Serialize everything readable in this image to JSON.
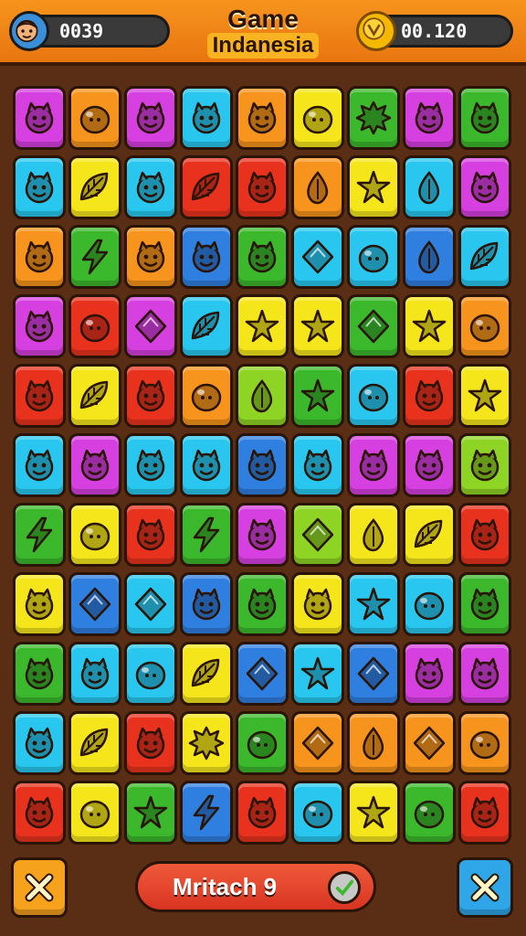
{
  "header": {
    "player_score": "0039",
    "coins": "00.120",
    "title_line1": "Game",
    "title_line2": "Indanesia"
  },
  "footer": {
    "match_label": "Mritach 9"
  },
  "colors": {
    "orange": "#f7941d",
    "yellow": "#f4e61b",
    "magenta": "#d63fe0",
    "cyan": "#29c7ef",
    "red": "#e8321e",
    "green": "#3bb82c",
    "blue": "#2f7fe0",
    "lime": "#8ed424"
  },
  "board": [
    [
      {
        "c": "magenta",
        "i": "face"
      },
      {
        "c": "orange",
        "i": "blob"
      },
      {
        "c": "magenta",
        "i": "face"
      },
      {
        "c": "cyan",
        "i": "face"
      },
      {
        "c": "orange",
        "i": "face"
      },
      {
        "c": "yellow",
        "i": "blob"
      },
      {
        "c": "green",
        "i": "splat"
      },
      {
        "c": "magenta",
        "i": "face"
      },
      {
        "c": "green",
        "i": "face"
      }
    ],
    [
      {
        "c": "cyan",
        "i": "face"
      },
      {
        "c": "yellow",
        "i": "leaf"
      },
      {
        "c": "cyan",
        "i": "face"
      },
      {
        "c": "red",
        "i": "leaf"
      },
      {
        "c": "red",
        "i": "face"
      },
      {
        "c": "orange",
        "i": "drop"
      },
      {
        "c": "yellow",
        "i": "star"
      },
      {
        "c": "cyan",
        "i": "drop"
      },
      {
        "c": "magenta",
        "i": "face"
      }
    ],
    [
      {
        "c": "orange",
        "i": "face"
      },
      {
        "c": "green",
        "i": "bolt"
      },
      {
        "c": "orange",
        "i": "face"
      },
      {
        "c": "blue",
        "i": "face"
      },
      {
        "c": "green",
        "i": "face"
      },
      {
        "c": "cyan",
        "i": "gem"
      },
      {
        "c": "cyan",
        "i": "blob"
      },
      {
        "c": "blue",
        "i": "drop"
      },
      {
        "c": "cyan",
        "i": "leaf"
      }
    ],
    [
      {
        "c": "magenta",
        "i": "face"
      },
      {
        "c": "red",
        "i": "blob"
      },
      {
        "c": "magenta",
        "i": "gem"
      },
      {
        "c": "cyan",
        "i": "leaf"
      },
      {
        "c": "yellow",
        "i": "star"
      },
      {
        "c": "yellow",
        "i": "star"
      },
      {
        "c": "green",
        "i": "gem"
      },
      {
        "c": "yellow",
        "i": "star"
      },
      {
        "c": "orange",
        "i": "blob"
      }
    ],
    [
      {
        "c": "red",
        "i": "face"
      },
      {
        "c": "yellow",
        "i": "leaf"
      },
      {
        "c": "red",
        "i": "face"
      },
      {
        "c": "orange",
        "i": "blob"
      },
      {
        "c": "lime",
        "i": "drop"
      },
      {
        "c": "green",
        "i": "star"
      },
      {
        "c": "cyan",
        "i": "blob"
      },
      {
        "c": "red",
        "i": "face"
      },
      {
        "c": "yellow",
        "i": "star"
      }
    ],
    [
      {
        "c": "cyan",
        "i": "face"
      },
      {
        "c": "magenta",
        "i": "face"
      },
      {
        "c": "cyan",
        "i": "face"
      },
      {
        "c": "cyan",
        "i": "face"
      },
      {
        "c": "blue",
        "i": "face"
      },
      {
        "c": "cyan",
        "i": "face"
      },
      {
        "c": "magenta",
        "i": "face"
      },
      {
        "c": "magenta",
        "i": "face"
      },
      {
        "c": "lime",
        "i": "face"
      }
    ],
    [
      {
        "c": "green",
        "i": "bolt"
      },
      {
        "c": "yellow",
        "i": "blob"
      },
      {
        "c": "red",
        "i": "face"
      },
      {
        "c": "green",
        "i": "bolt"
      },
      {
        "c": "magenta",
        "i": "face"
      },
      {
        "c": "lime",
        "i": "gem"
      },
      {
        "c": "yellow",
        "i": "drop"
      },
      {
        "c": "yellow",
        "i": "leaf"
      },
      {
        "c": "red",
        "i": "face"
      }
    ],
    [
      {
        "c": "yellow",
        "i": "face"
      },
      {
        "c": "blue",
        "i": "gem"
      },
      {
        "c": "cyan",
        "i": "gem"
      },
      {
        "c": "blue",
        "i": "face"
      },
      {
        "c": "green",
        "i": "face"
      },
      {
        "c": "yellow",
        "i": "face"
      },
      {
        "c": "cyan",
        "i": "star"
      },
      {
        "c": "cyan",
        "i": "blob"
      },
      {
        "c": "green",
        "i": "face"
      }
    ],
    [
      {
        "c": "green",
        "i": "face"
      },
      {
        "c": "cyan",
        "i": "face"
      },
      {
        "c": "cyan",
        "i": "blob"
      },
      {
        "c": "yellow",
        "i": "leaf"
      },
      {
        "c": "blue",
        "i": "gem"
      },
      {
        "c": "cyan",
        "i": "star"
      },
      {
        "c": "blue",
        "i": "gem"
      },
      {
        "c": "magenta",
        "i": "face"
      },
      {
        "c": "magenta",
        "i": "face"
      }
    ],
    [
      {
        "c": "cyan",
        "i": "face"
      },
      {
        "c": "yellow",
        "i": "leaf"
      },
      {
        "c": "red",
        "i": "face"
      },
      {
        "c": "yellow",
        "i": "splat"
      },
      {
        "c": "green",
        "i": "blob"
      },
      {
        "c": "orange",
        "i": "gem"
      },
      {
        "c": "orange",
        "i": "drop"
      },
      {
        "c": "orange",
        "i": "gem"
      },
      {
        "c": "orange",
        "i": "blob"
      }
    ],
    [
      {
        "c": "red",
        "i": "face"
      },
      {
        "c": "yellow",
        "i": "blob"
      },
      {
        "c": "green",
        "i": "star"
      },
      {
        "c": "blue",
        "i": "bolt"
      },
      {
        "c": "red",
        "i": "face"
      },
      {
        "c": "cyan",
        "i": "blob"
      },
      {
        "c": "yellow",
        "i": "star"
      },
      {
        "c": "green",
        "i": "blob"
      },
      {
        "c": "red",
        "i": "face"
      }
    ]
  ]
}
